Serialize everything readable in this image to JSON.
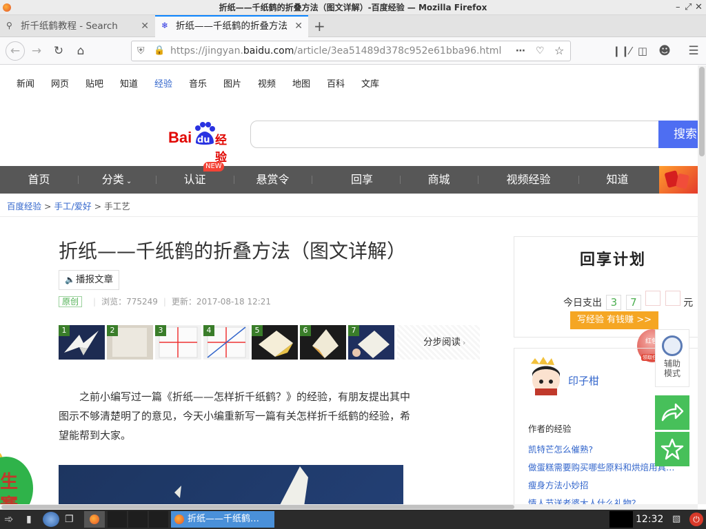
{
  "window": {
    "title": "折纸——千纸鹤的折叠方法（图文详解）-百度经验 — Mozilla Firefox"
  },
  "tabs": [
    {
      "label": "折千纸鹤教程 - Search",
      "active": false
    },
    {
      "label": "折纸——千纸鹤的折叠方法",
      "active": true
    }
  ],
  "urlbar": {
    "prefix": "https://jingyan.",
    "domain": "baidu.com",
    "path": "/article/3ea51489d378c952e61bba96.html"
  },
  "page": {
    "top_links": [
      "新闻",
      "网页",
      "贴吧",
      "知道",
      "经验",
      "音乐",
      "图片",
      "视频",
      "地图",
      "百科",
      "文库"
    ],
    "logo": {
      "bai": "Bai",
      "du": "du",
      "jy": "经验"
    },
    "search_button": "搜索",
    "menu": [
      "首页",
      "分类",
      "认证",
      "悬赏令",
      "回享",
      "商城",
      "视频经验",
      "知道"
    ],
    "new_badge": "NEW",
    "breadcrumb": {
      "a": "百度经验",
      "sep1": ">",
      "b": "手工/爱好",
      "sep2": ">",
      "c": "手工艺"
    },
    "article": {
      "title": "折纸——千纸鹤的折叠方法（图文详解）",
      "read_button": "播报文章",
      "original": "原创",
      "views": "浏览：775249",
      "updated": "更新：2017-08-18 12:21",
      "steps": [
        "1",
        "2",
        "3",
        "4",
        "5",
        "6",
        "7"
      ],
      "step_read": "分步阅读",
      "intro": "之前小编写过一篇《折纸——怎样折千纸鹤？》的经验，有朋友提出其中图示不够清楚明了的意见，今天小编重新写一篇有关怎样折千纸鹤的经验，希望能帮到大家。"
    },
    "huixiang": {
      "title": "回享计划",
      "today": "今日支出",
      "digits": [
        "3",
        "7"
      ],
      "unit": "元",
      "write_button": "写经验 有钱赚 >>",
      "redpacket": "红包",
      "redpacket_sub": "领取任务"
    },
    "author": {
      "name": "印子柑",
      "section": "作者的经验",
      "links": [
        "凯特芒怎么催熟?",
        "做蛋糕需要购买哪些原料和烘焙用具呢...",
        "瘦身方法小妙招",
        "情人节送老婆大人什么礼物？"
      ]
    },
    "float": {
      "assist": "辅助模式"
    },
    "left_badge": [
      "生活",
      "赛"
    ]
  },
  "taskbar": {
    "window_label": "折纸——千纸鹤…",
    "clock": "12:32"
  }
}
